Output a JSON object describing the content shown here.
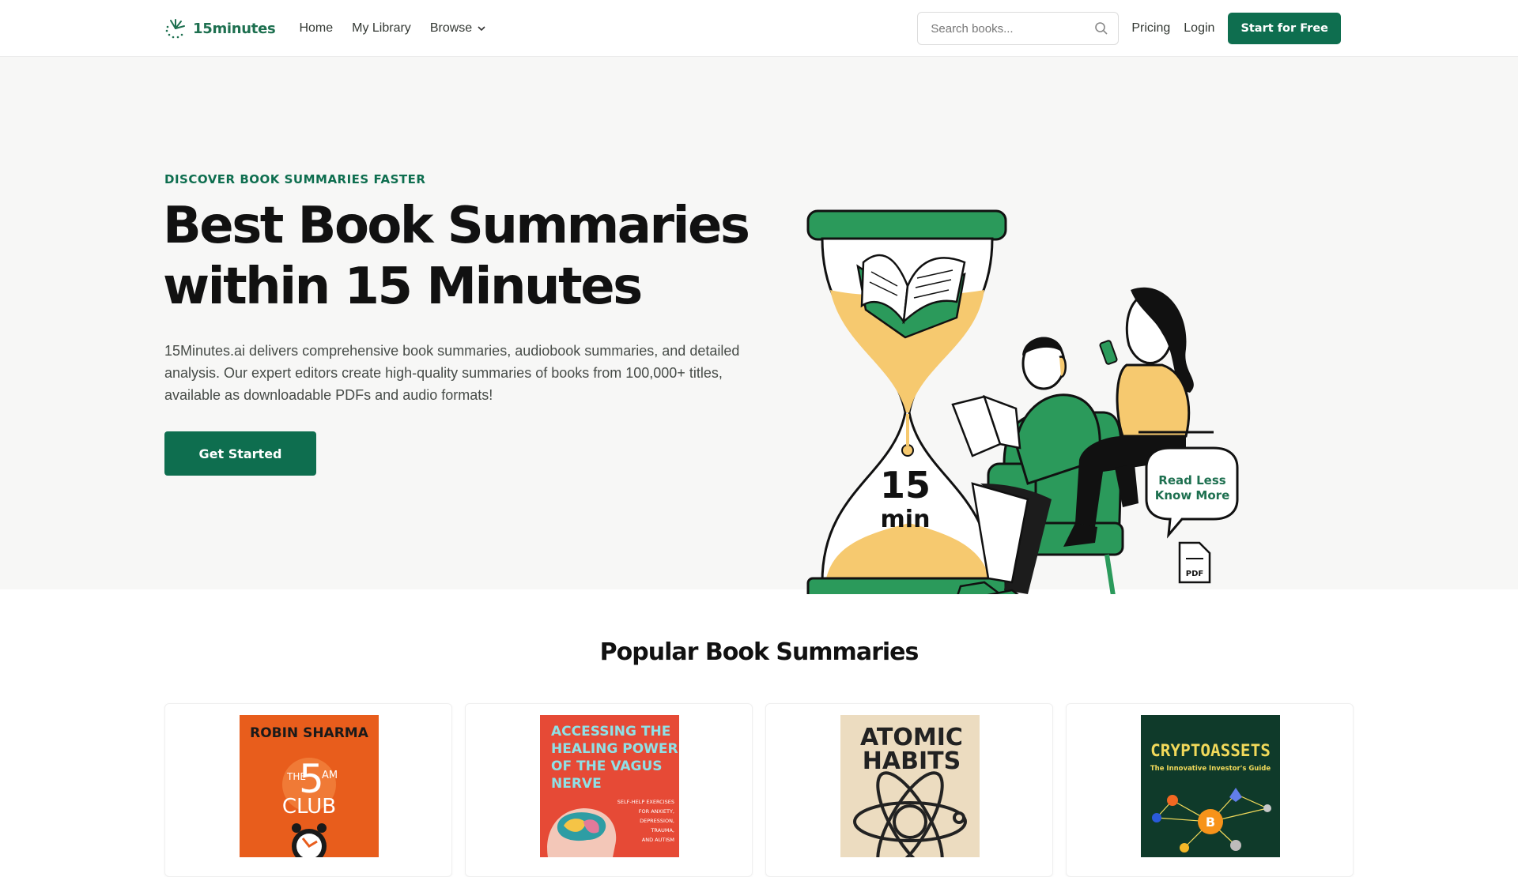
{
  "nav": {
    "logo_text": "15minutes",
    "links": [
      "Home",
      "My Library",
      "Browse"
    ],
    "search_placeholder": "Search books...",
    "pricing": "Pricing",
    "login": "Login",
    "cta": "Start for Free"
  },
  "hero": {
    "eyebrow": "DISCOVER BOOK SUMMARIES FASTER",
    "title_line1": "Best Book Summaries",
    "title_line2": "within 15 Minutes",
    "description": "15Minutes.ai delivers comprehensive book summaries, audiobook summaries, and detailed analysis. Our expert editors create high-quality summaries of books from 100,000+ titles, available as downloadable PDFs and audio formats!",
    "button": "Get Started",
    "illustration": {
      "timer_number": "15",
      "timer_unit": "min",
      "bubble_line1": "Read Less",
      "bubble_line2": "Know More",
      "file_label": "PDF"
    }
  },
  "popular": {
    "title": "Popular Book Summaries",
    "books": [
      {
        "author": "ROBIN SHARMA",
        "title_small": "THE",
        "title_big": "5",
        "title_sup": "AM",
        "title_bottom": "CLUB",
        "color": "#e85d1c"
      },
      {
        "title_lines": [
          "ACCESSING THE",
          "HEALING POWER",
          "OF THE VAGUS",
          "NERVE"
        ],
        "subtitle_lines": [
          "SELF-HELP EXERCISES",
          "FOR ANXIETY,",
          "DEPRESSION,",
          "TRAUMA,",
          "AND AUTISM"
        ],
        "color": "#e64a36"
      },
      {
        "title_lines": [
          "ATOMIC",
          "HABITS"
        ],
        "color": "#ecdcc0"
      },
      {
        "title": "CRYPTOASSETS",
        "subtitle": "The Innovative Investor's Guide",
        "color": "#0f3a2a"
      }
    ]
  },
  "colors": {
    "brand": "#0e6e4f",
    "hero_bg": "#f7f7f6",
    "accent_yellow": "#f6c96f",
    "accent_green": "#2b9a5b"
  }
}
